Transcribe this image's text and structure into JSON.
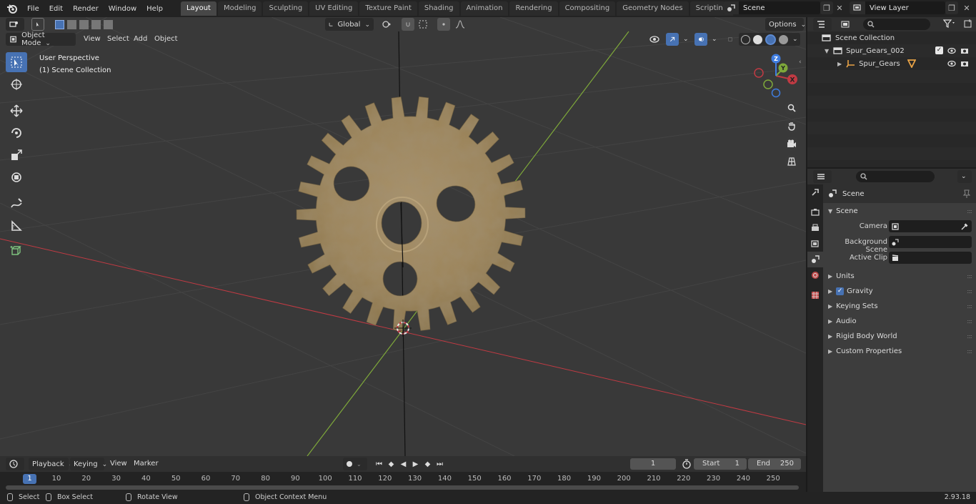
{
  "topbar": {
    "menus": [
      "File",
      "Edit",
      "Render",
      "Window",
      "Help"
    ],
    "workspaces": [
      "Layout",
      "Modeling",
      "Sculpting",
      "UV Editing",
      "Texture Paint",
      "Shading",
      "Animation",
      "Rendering",
      "Compositing",
      "Geometry Nodes",
      "Scripting"
    ],
    "active_workspace": "Layout",
    "add_tab": "+",
    "scene_name": "Scene",
    "view_layer_name": "View Layer"
  },
  "viewport": {
    "mode": "Object Mode",
    "menus": [
      "View",
      "Select",
      "Add",
      "Object"
    ],
    "transform_orientation": "Global",
    "options_label": "Options",
    "perspective_label": "User Perspective",
    "collection_label": "(1) Scene Collection",
    "gizmo_labels": {
      "x": "X",
      "y": "Y",
      "z": "Z"
    }
  },
  "outliner": {
    "root": "Scene Collection",
    "collection": "Spur_Gears_002",
    "object": "Spur_Gears"
  },
  "properties": {
    "context_title": "Scene",
    "scene_panel_title": "Scene",
    "rows": [
      {
        "label": "Camera",
        "value": ""
      },
      {
        "label": "Background Scene",
        "value": ""
      },
      {
        "label": "Active Clip",
        "value": ""
      }
    ],
    "subpanels": [
      "Units",
      "Gravity",
      "Keying Sets",
      "Audio",
      "Rigid Body World",
      "Custom Properties"
    ],
    "gravity_checked": true
  },
  "timeline": {
    "menus": [
      "Playback",
      "Keying",
      "View",
      "Marker"
    ],
    "current_frame": "1",
    "start_label": "Start",
    "start_value": "1",
    "end_label": "End",
    "end_value": "250",
    "ruler_ticks": [
      "1",
      "10",
      "20",
      "30",
      "40",
      "50",
      "60",
      "70",
      "80",
      "90",
      "100",
      "110",
      "120",
      "130",
      "140",
      "150",
      "160",
      "170",
      "180",
      "190",
      "200",
      "210",
      "220",
      "230",
      "240",
      "250"
    ]
  },
  "statusbar": {
    "select": "Select",
    "box_select": "Box Select",
    "rotate_view": "Rotate View",
    "context_menu": "Object Context Menu",
    "version": "2.93.18"
  },
  "colors": {
    "accent": "#4772b3",
    "x_axis": "#c03a43",
    "y_axis": "#7ea83a",
    "z_axis": "#3f7de0",
    "gear": "#a28a61"
  }
}
